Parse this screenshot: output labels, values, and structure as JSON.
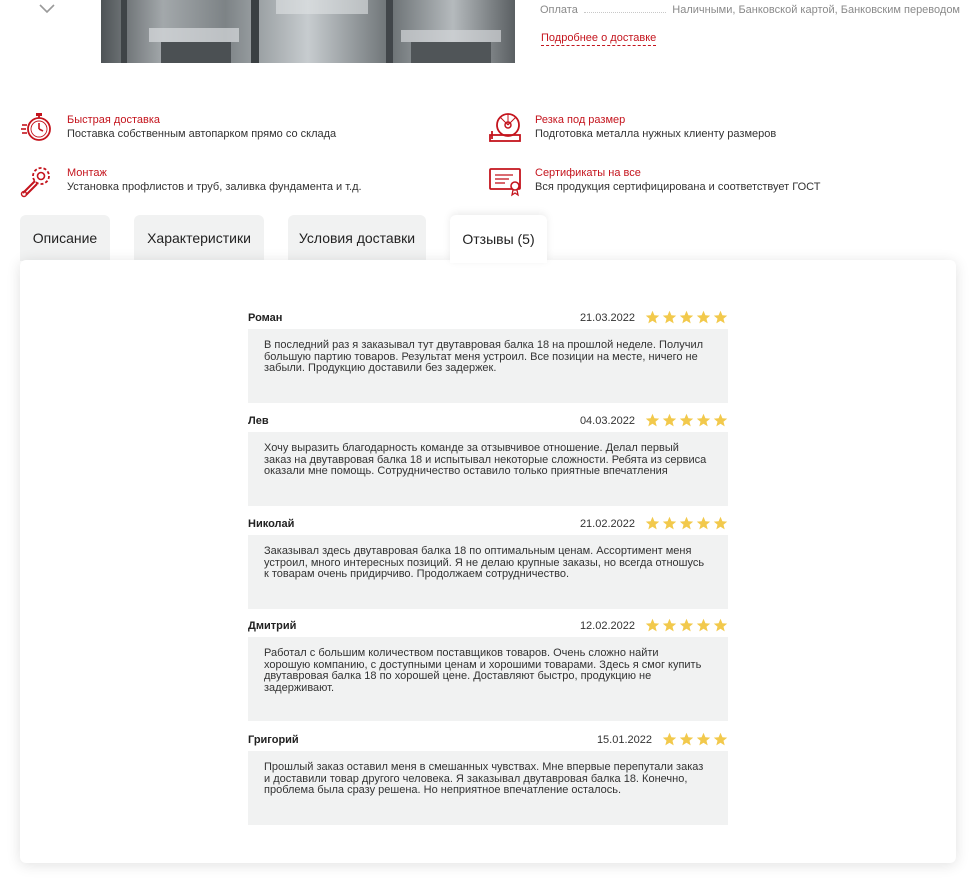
{
  "payment": {
    "label": "Оплата",
    "value": "Наличными, Банковской картой, Банковским переводом",
    "delivery_link": "Подробнее о доставке"
  },
  "features": [
    {
      "title": "Быстрая доставка",
      "desc": "Поставка собственным автопарком прямо со склада",
      "icon": "stopwatch-icon"
    },
    {
      "title": "Резка под размер",
      "desc": "Подготовка металла нужных клиенту размеров",
      "icon": "circular-saw-icon"
    },
    {
      "title": "Монтаж",
      "desc": "Установка профлистов и труб, заливка фундамента и т.д.",
      "icon": "wrench-gear-icon"
    },
    {
      "title": "Сертификаты на все",
      "desc": "Вся продукция сертифицирована и соответствует ГОСТ",
      "icon": "certificate-icon"
    }
  ],
  "tabs": [
    {
      "label": "Описание",
      "active": false
    },
    {
      "label": "Характеристики",
      "active": false
    },
    {
      "label": "Условия доставки",
      "active": false
    },
    {
      "label": "Отзывы (5)",
      "active": true
    }
  ],
  "reviews": [
    {
      "name": "Роман",
      "date": "21.03.2022",
      "stars": 5,
      "lines": [
        "В последний раз я заказывал тут двутавровая балка 18 на прошлой неделе. Получил",
        "большую партию товаров. Результат меня устроил. Все позиции на месте, ничего не",
        "забыли. Продукцию доставили без задержек."
      ]
    },
    {
      "name": "Лев",
      "date": "04.03.2022",
      "stars": 5,
      "lines": [
        "Хочу выразить благодарность команде за отзывчивое отношение. Делал первый",
        "заказ на двутавровая балка 18 и испытывал некоторые сложности. Ребята из сервиса",
        "оказали мне помощь. Сотрудничество оставило только приятные впечатления"
      ]
    },
    {
      "name": "Николай",
      "date": "21.02.2022",
      "stars": 5,
      "lines": [
        "Заказывал здесь двутавровая балка 18 по оптимальным ценам. Ассортимент меня",
        "устроил, много интересных позиций. Я не делаю крупные заказы, но всегда отношусь",
        "к товарам очень придирчиво. Продолжаем сотрудничество."
      ]
    },
    {
      "name": "Дмитрий",
      "date": "12.02.2022",
      "stars": 5,
      "lines": [
        "Работал с большим количеством поставщиков товаров. Очень сложно найти",
        "хорошую компанию, с доступными ценам и хорошими товарами. Здесь я смог купить",
        "двутавровая балка 18 по хорошей цене. Доставляют быстро, продукцию не",
        "задерживают."
      ]
    },
    {
      "name": "Григорий",
      "date": "15.01.2022",
      "stars": 4,
      "lines": [
        "Прошлый заказ оставил меня в смешанных чувствах. Мне впервые перепутали заказ",
        "и доставили товар другого человека. Я заказывал двутавровая балка 18. Конечно,",
        "проблема была сразу решена. Но неприятное впечатление осталось."
      ]
    }
  ],
  "colors": {
    "accent": "#c4141d",
    "star": "#f2c94c",
    "panel_bg": "#f1f2f2"
  }
}
